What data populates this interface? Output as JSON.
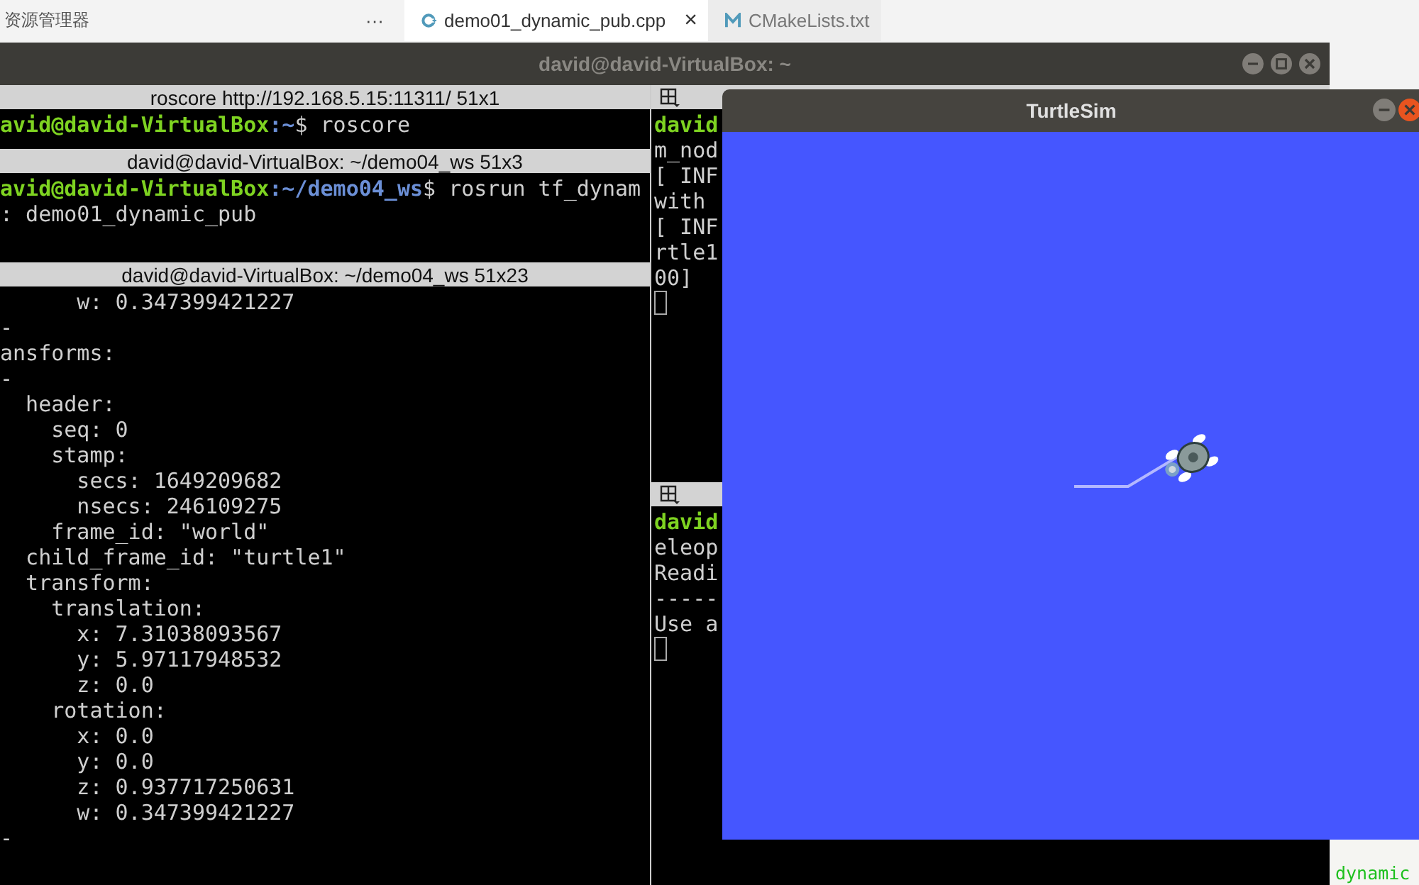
{
  "editor_bar": {
    "explorer_label": "资源管理器",
    "more": "···",
    "tabs": [
      {
        "label": "demo01_dynamic_pub.cpp",
        "kind": "cpp",
        "selected": true,
        "close": "×"
      },
      {
        "label": "CMakeLists.txt",
        "kind": "cmake",
        "selected": false
      }
    ],
    "peek_line": "dynamic"
  },
  "terminal": {
    "title": "david@david-VirtualBox: ~",
    "left_panes": [
      {
        "title": "roscore http://192.168.5.15:11311/ 51x1",
        "lines": [
          {
            "kind": "prompt",
            "user": "avid@david-VirtualBox",
            "path": ":~",
            "command": "$ roscore"
          }
        ]
      },
      {
        "title": "david@david-VirtualBox: ~/demo04_ws 51x3",
        "lines": [
          {
            "kind": "prompt",
            "user": "avid@david-VirtualBox",
            "path": ":~/demo04_ws",
            "command": "$ rosrun tf_dynam"
          },
          {
            "kind": "text",
            "text": ": demo01_dynamic_pub"
          }
        ]
      },
      {
        "title": "david@david-VirtualBox: ~/demo04_ws 51x23",
        "lines": [
          {
            "kind": "text",
            "text": "      w: 0.347399421227"
          },
          {
            "kind": "text",
            "text": "-"
          },
          {
            "kind": "text",
            "text": "ansforms:"
          },
          {
            "kind": "text",
            "text": "-"
          },
          {
            "kind": "text",
            "text": "  header:"
          },
          {
            "kind": "text",
            "text": "    seq: 0"
          },
          {
            "kind": "text",
            "text": "    stamp:"
          },
          {
            "kind": "text",
            "text": "      secs: 1649209682"
          },
          {
            "kind": "text",
            "text": "      nsecs: 246109275"
          },
          {
            "kind": "text",
            "text": "    frame_id: \"world\""
          },
          {
            "kind": "text",
            "text": "  child_frame_id: \"turtle1\""
          },
          {
            "kind": "text",
            "text": "  transform:"
          },
          {
            "kind": "text",
            "text": "    translation:"
          },
          {
            "kind": "text",
            "text": "      x: 7.31038093567"
          },
          {
            "kind": "text",
            "text": "      y: 5.97117948532"
          },
          {
            "kind": "text",
            "text": "      z: 0.0"
          },
          {
            "kind": "text",
            "text": "    rotation:"
          },
          {
            "kind": "text",
            "text": "      x: 0.0"
          },
          {
            "kind": "text",
            "text": "      y: 0.0"
          },
          {
            "kind": "text",
            "text": "      z: 0.937717250631"
          },
          {
            "kind": "text",
            "text": "      w: 0.347399421227"
          },
          {
            "kind": "text",
            "text": "-"
          }
        ]
      }
    ],
    "right_panes": [
      {
        "lines": [
          {
            "kind": "prompt",
            "user": "david"
          },
          {
            "kind": "text",
            "text": "m_nod"
          },
          {
            "kind": "text",
            "text": "[ INF"
          },
          {
            "kind": "text",
            "text": "with"
          },
          {
            "kind": "text",
            "text": "[ INF"
          },
          {
            "kind": "text",
            "text": "rtle1"
          },
          {
            "kind": "text",
            "text": "00]"
          },
          {
            "kind": "cursor"
          }
        ]
      },
      {
        "lines": [
          {
            "kind": "prompt",
            "user": "david"
          },
          {
            "kind": "text",
            "text": "eleop"
          },
          {
            "kind": "text",
            "text": "Readi"
          },
          {
            "kind": "text",
            "text": "-----"
          },
          {
            "kind": "text",
            "text": "Use a"
          },
          {
            "kind": "cursor"
          }
        ]
      }
    ]
  },
  "turtlesim": {
    "title": "TurtleSim"
  }
}
